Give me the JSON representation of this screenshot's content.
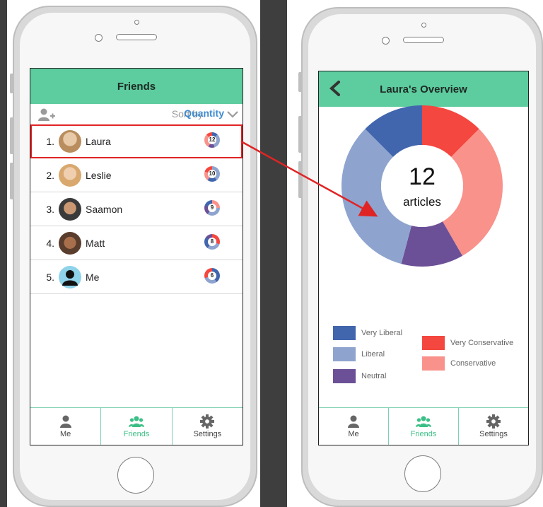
{
  "friends_screen": {
    "title": "Friends",
    "sort_label": "Sort by:",
    "sort_value": "Quantity",
    "friends": [
      {
        "rank": "1.",
        "name": "Laura",
        "count": "12",
        "selected": true
      },
      {
        "rank": "2.",
        "name": "Leslie",
        "count": "10",
        "selected": false
      },
      {
        "rank": "3.",
        "name": "Saamon",
        "count": "9",
        "selected": false
      },
      {
        "rank": "4.",
        "name": "Matt",
        "count": "8",
        "selected": false
      },
      {
        "rank": "5.",
        "name": "Me",
        "count": "6",
        "selected": false
      }
    ],
    "tabs": [
      {
        "label": "Me",
        "icon": "person-icon",
        "active": false
      },
      {
        "label": "Friends",
        "icon": "friends-icon",
        "active": true
      },
      {
        "label": "Settings",
        "icon": "gear-icon",
        "active": false
      }
    ]
  },
  "overview_screen": {
    "title": "Laura's Overview",
    "count": "12",
    "unit": "articles",
    "chart_data": {
      "type": "pie",
      "categories": [
        "Very Liberal",
        "Liberal",
        "Neutral",
        "Very Conservative",
        "Conservative"
      ],
      "values": [
        1.5,
        4,
        1.5,
        1.5,
        3.5
      ],
      "colors": [
        "#4266ad",
        "#8ea4cf",
        "#6b5097",
        "#f4473f",
        "#f8928b"
      ]
    },
    "legend": [
      {
        "label": "Very Liberal",
        "color": "#4266ad"
      },
      {
        "label": "Liberal",
        "color": "#8ea4cf"
      },
      {
        "label": "Neutral",
        "color": "#6b5097"
      },
      {
        "label": "Very Conservative",
        "color": "#f4473f"
      },
      {
        "label": "Conservative",
        "color": "#f8928b"
      }
    ],
    "tabs": [
      {
        "label": "Me",
        "icon": "person-icon",
        "active": false
      },
      {
        "label": "Friends",
        "icon": "friends-icon",
        "active": true
      },
      {
        "label": "Settings",
        "icon": "gear-icon",
        "active": false
      }
    ]
  },
  "colors": {
    "header": "#5dcc9f",
    "accent": "#3cbf86",
    "sort_value": "#3f8bd1",
    "highlight": "#e02424"
  }
}
